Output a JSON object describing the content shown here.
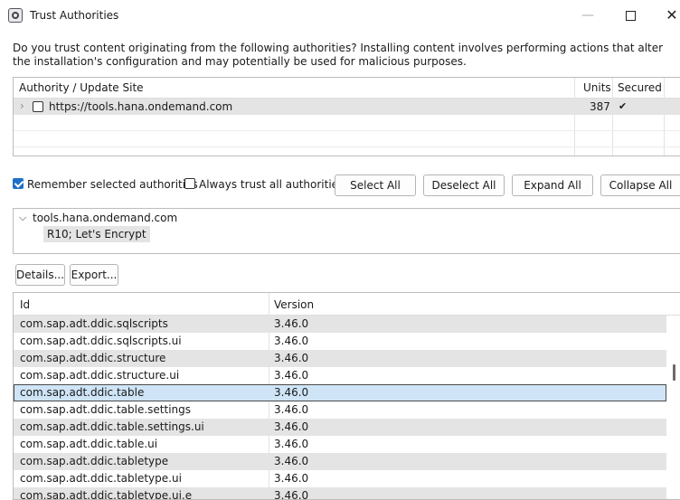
{
  "window": {
    "title": "Trust Authorities",
    "minimize": "—",
    "close": "✕"
  },
  "message": "Do you trust content originating from the following authorities?  Installing content involves performing actions that alter the installation's configuration and may potentially be used for malicious purposes.",
  "authorities_table": {
    "columns": [
      "Authority / Update Site",
      "Units",
      "Secured"
    ],
    "rows": [
      {
        "site": "https://tools.hana.ondemand.com",
        "units": "387",
        "secured": "✔",
        "checked": false
      }
    ]
  },
  "options": {
    "remember_label": "Remember selected authorities",
    "remember_checked": true,
    "always_trust_label": "Always trust all authorities",
    "always_trust_checked": false
  },
  "buttons": {
    "select_all": "Select All",
    "deselect_all": "Deselect All",
    "expand_all": "Expand All",
    "collapse_all": "Collapse All",
    "details": "Details...",
    "export": "Export..."
  },
  "certificate_tree": {
    "root": "tools.hana.ondemand.com",
    "child": "R10; Let's Encrypt"
  },
  "units_table": {
    "columns": [
      "Id",
      "Version"
    ],
    "selected_index": 4,
    "rows": [
      {
        "id": "com.sap.adt.ddic.sqlscripts",
        "version": "3.46.0"
      },
      {
        "id": "com.sap.adt.ddic.sqlscripts.ui",
        "version": "3.46.0"
      },
      {
        "id": "com.sap.adt.ddic.structure",
        "version": "3.46.0"
      },
      {
        "id": "com.sap.adt.ddic.structure.ui",
        "version": "3.46.0"
      },
      {
        "id": "com.sap.adt.ddic.table",
        "version": "3.46.0"
      },
      {
        "id": "com.sap.adt.ddic.table.settings",
        "version": "3.46.0"
      },
      {
        "id": "com.sap.adt.ddic.table.settings.ui",
        "version": "3.46.0"
      },
      {
        "id": "com.sap.adt.ddic.table.ui",
        "version": "3.46.0"
      },
      {
        "id": "com.sap.adt.ddic.tabletype",
        "version": "3.46.0"
      },
      {
        "id": "com.sap.adt.ddic.tabletype.ui",
        "version": "3.46.0"
      },
      {
        "id": "com.sap.adt.ddic.tabletype.ui.e",
        "version": "3.46.0"
      }
    ]
  },
  "colors": {
    "accent": "#1f6fc7",
    "row_alt": "#e4e4e4",
    "row_selected": "#cfe5f7"
  }
}
